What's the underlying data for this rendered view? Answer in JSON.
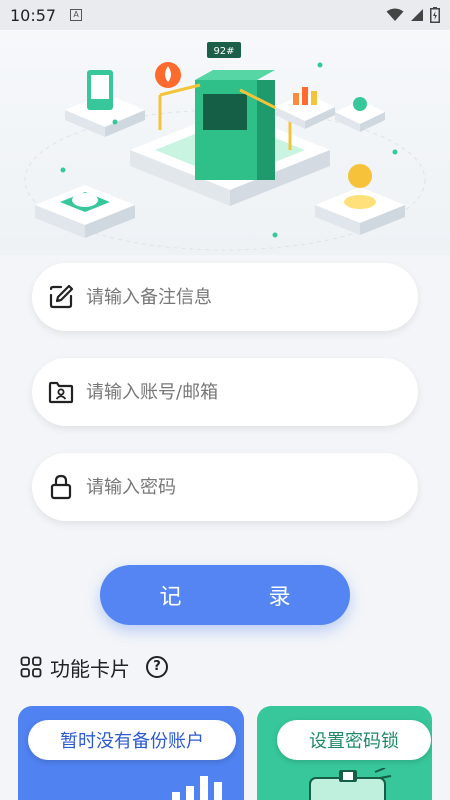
{
  "status_bar": {
    "time": "10:57",
    "notification_letter": "A"
  },
  "form": {
    "note_placeholder": "请输入备注信息",
    "account_placeholder": "请输入账号/邮箱",
    "password_placeholder": "请输入密码",
    "record_label": "记 录"
  },
  "features": {
    "title": "功能卡片",
    "cards": [
      {
        "label": "暂时没有备份账户"
      },
      {
        "label": "设置密码锁"
      }
    ]
  },
  "colors": {
    "primary": "#5485f3",
    "card_blue": "#5082f1",
    "card_green": "#37c79a",
    "background": "#f3f5f8"
  },
  "illustration": {
    "pump_label": "92#"
  }
}
